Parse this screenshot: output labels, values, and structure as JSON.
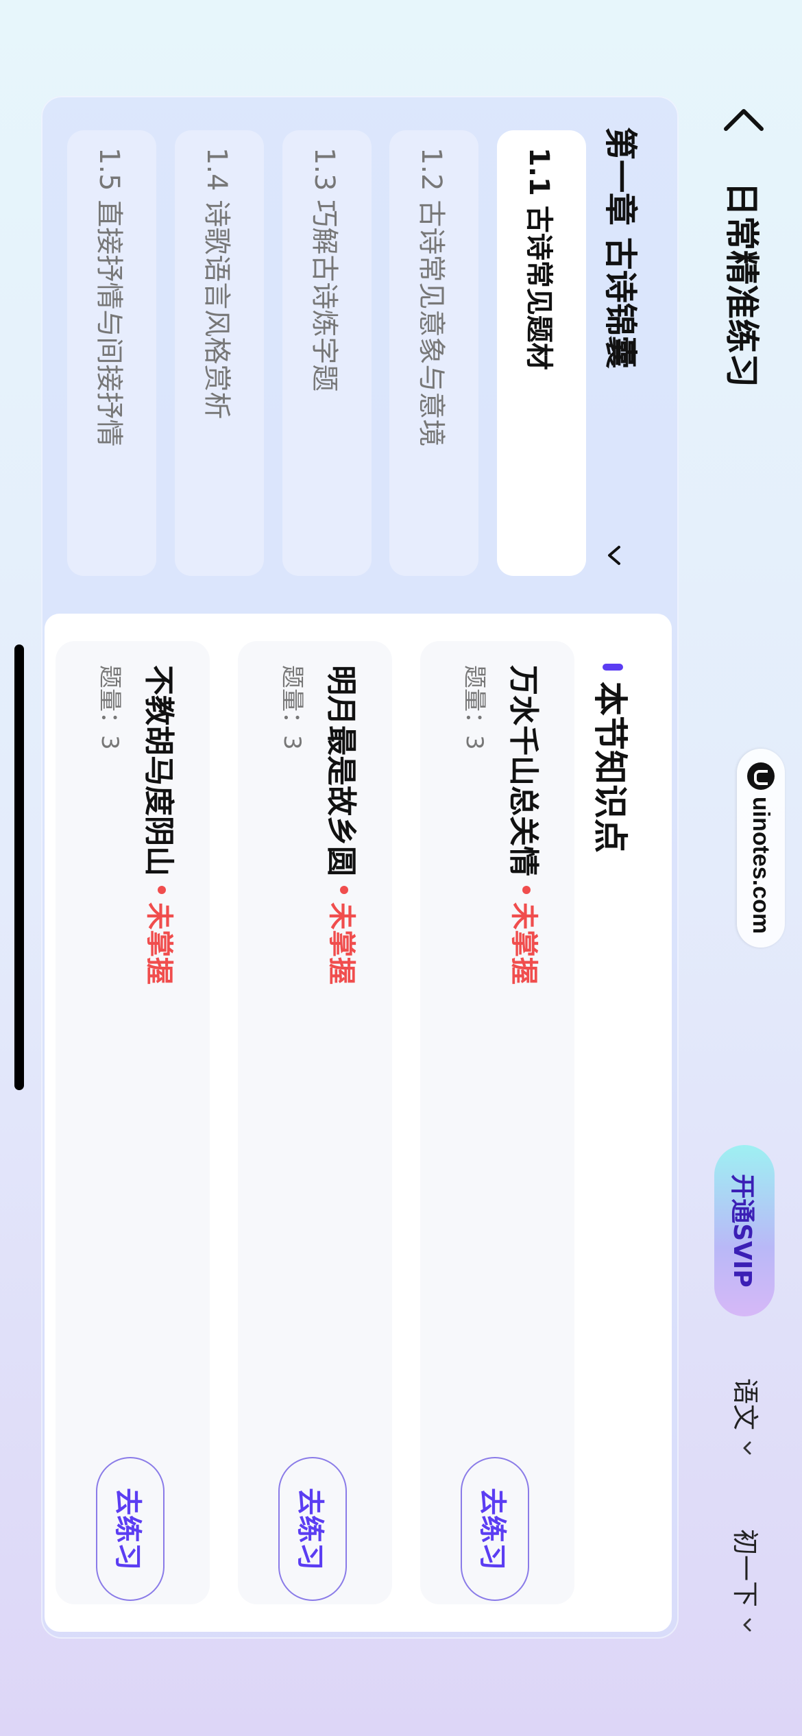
{
  "watermark": {
    "text": "uinotes.com"
  },
  "header": {
    "title": "日常精准练习",
    "svip_label": "开通SVIP",
    "subject": "语文",
    "grade": "初一下"
  },
  "chapter": {
    "title": "第一章 古诗锦囊",
    "sections": [
      {
        "label": "1.1 古诗常见题材",
        "active": true
      },
      {
        "label": "1.2 古诗常见意象与意境"
      },
      {
        "label": "1.3 巧解古诗炼字题"
      },
      {
        "label": "1.4 诗歌语言风格赏析"
      },
      {
        "label": "1.5 直接抒情与间接抒情"
      }
    ]
  },
  "knowledge": {
    "title": "本节知识点",
    "items": [
      {
        "name": "万水千山总关情",
        "status": "未掌握",
        "qty_label": "题量：3",
        "action": "去练习"
      },
      {
        "name": "明月最是故乡圆",
        "status": "未掌握",
        "qty_label": "题量：3",
        "action": "去练习"
      },
      {
        "name": "不教胡马度阴山",
        "status": "未掌握",
        "qty_label": "题量：3",
        "action": "去练习"
      }
    ]
  },
  "colors": {
    "accent": "#5b3df2",
    "status_red": "#f04d4d"
  }
}
